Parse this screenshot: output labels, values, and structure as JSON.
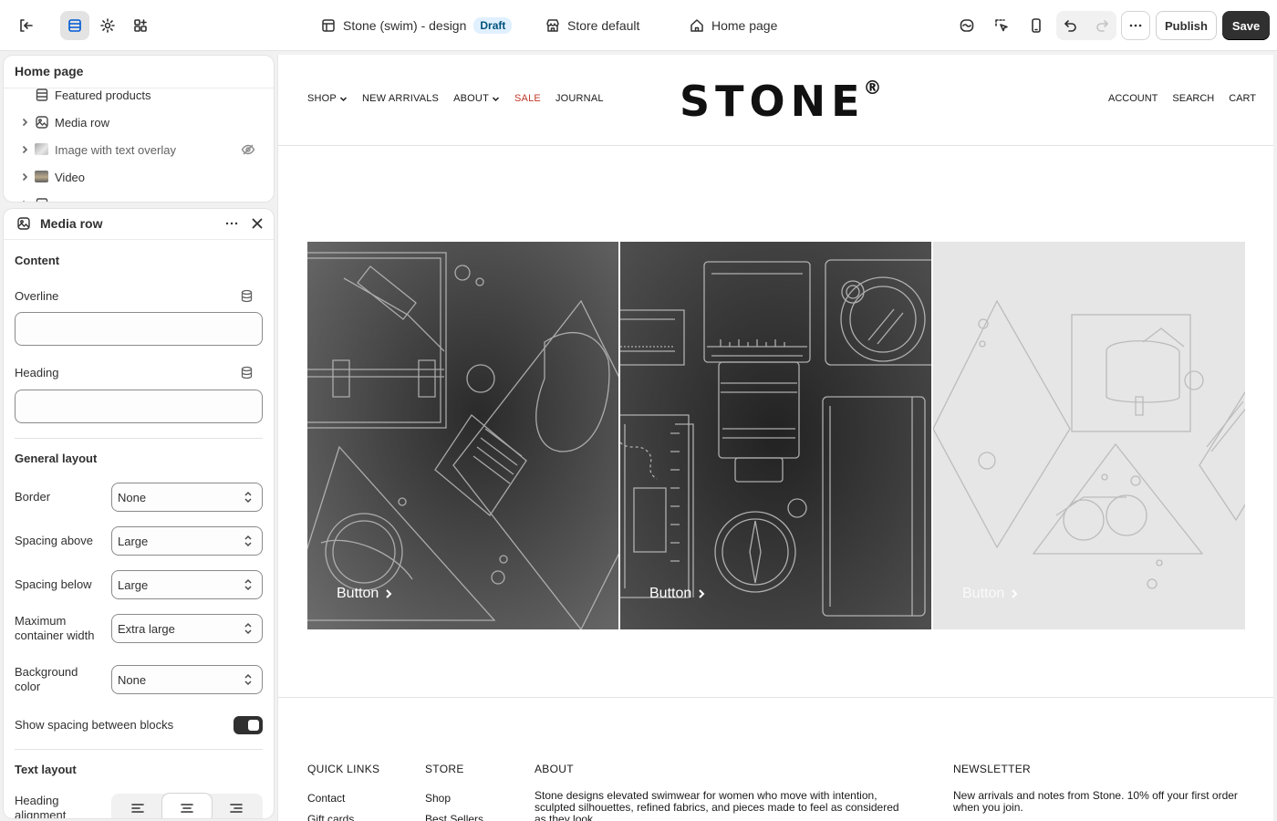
{
  "topbar": {
    "theme_name": "Stone (swim) - design",
    "theme_status": "Draft",
    "store_context": "Store default",
    "page_context": "Home page",
    "publish_label": "Publish",
    "save_label": "Save"
  },
  "tree": {
    "title": "Home page",
    "items": [
      {
        "label": "Featured products"
      },
      {
        "label": "Media row"
      },
      {
        "label": "Image with text overlay"
      },
      {
        "label": "Video"
      }
    ]
  },
  "settings": {
    "title": "Media row",
    "content_heading": "Content",
    "overline_label": "Overline",
    "overline_value": "",
    "heading_label": "Heading",
    "heading_value": "",
    "general_layout_heading": "General layout",
    "fields": [
      {
        "label": "Border",
        "value": "None"
      },
      {
        "label": "Spacing above",
        "value": "Large"
      },
      {
        "label": "Spacing below",
        "value": "Large"
      },
      {
        "label": "Maximum container width",
        "value": "Extra large"
      },
      {
        "label": "Background color",
        "value": "None"
      }
    ],
    "spacing_toggle_label": "Show spacing between blocks",
    "spacing_toggle_on": true,
    "text_layout_heading": "Text layout",
    "heading_alignment_label": "Heading alignment",
    "heading_alignment_selected": "center"
  },
  "preview": {
    "nav_left": [
      "SHOP",
      "NEW ARRIVALS",
      "ABOUT",
      "SALE",
      "JOURNAL"
    ],
    "logo": "STONE",
    "logo_mark": "®",
    "nav_right": [
      "ACCOUNT",
      "SEARCH",
      "CART"
    ],
    "tiles": [
      {
        "button": "Button"
      },
      {
        "button": "Button"
      },
      {
        "button": "Button"
      }
    ],
    "footer": {
      "quick_links_title": "QUICK LINKS",
      "quick_links": [
        "Contact",
        "Gift cards"
      ],
      "store_title": "STORE",
      "store_links": [
        "Shop",
        "Best Sellers"
      ],
      "about_title": "ABOUT",
      "about_text": "Stone designs elevated swimwear for women who move with intention, sculpted silhouettes, refined fabrics, and pieces made to feel as considered as they look.",
      "newsletter_title": "NEWSLETTER",
      "newsletter_text": "New arrivals and notes from Stone. 10% off your first order when you join."
    }
  },
  "colors": {
    "accent": "#005bd3",
    "sale": "#c0392b",
    "draft_badge_bg": "#e0f0ff",
    "primary_button": "#303030"
  }
}
